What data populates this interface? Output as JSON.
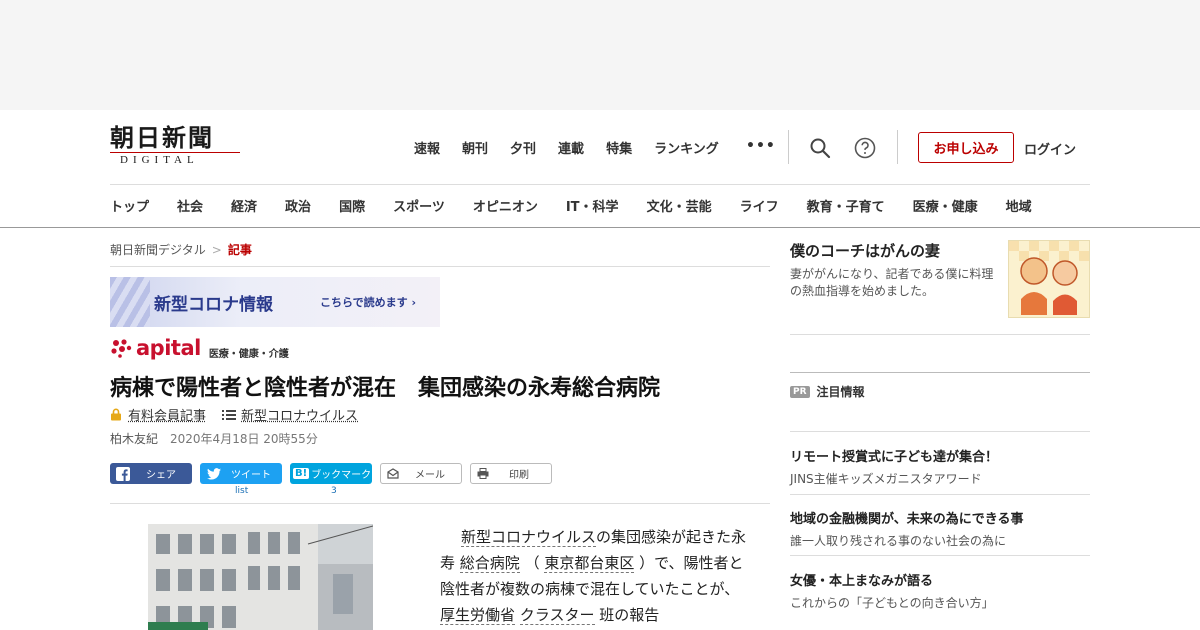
{
  "logo": {
    "main": "朝日新聞",
    "sub": "DIGITAL"
  },
  "topnav": [
    "速報",
    "朝刊",
    "夕刊",
    "連載",
    "特集",
    "ランキング"
  ],
  "more_label": "•••",
  "apply_label": "お申し込み",
  "login_label": "ログイン",
  "catnav": [
    "トップ",
    "社会",
    "経済",
    "政治",
    "国際",
    "スポーツ",
    "オピニオン",
    "IT・科学",
    "文化・芸能",
    "ライフ",
    "教育・子育て",
    "医療・健康",
    "地域"
  ],
  "breadcrumb": {
    "home": "朝日新聞デジタル",
    "sep": ">",
    "current": "記事"
  },
  "corona": {
    "title": "新型コロナ情報",
    "link": "こちらで読めます"
  },
  "apital": {
    "word": "apital",
    "sub": "医療・健康・介護"
  },
  "article": {
    "headline": "病棟で陽性者と陰性者が混在　集団感染の永寿総合病院",
    "member": "有料会員記事",
    "topic": "新型コロナウイルス",
    "author": "柏木友紀",
    "date": "2020年4月18日 20時55分",
    "body": {
      "p1_a": "新型コロナウイルス",
      "p1_b": "の集団感染が起きた永寿 ",
      "p1_c": "総合病院",
      "p1_d": " （ ",
      "p1_e": "東京都台東区",
      "p1_f": " ）で、陽性者と陰性者が複数の病棟で混在していたことが、 ",
      "p1_g": "厚生労働省",
      "p1_h": " ",
      "p1_i": "クラスター",
      "p1_j": " 班の報告"
    }
  },
  "share": {
    "facebook": "シェア",
    "twitter": "ツイート",
    "twitter_count": "list",
    "hatena_badge": "B!",
    "hatena": "ブックマーク",
    "hatena_count": "3",
    "mail": "メール",
    "print": "印刷"
  },
  "promo": {
    "title": "僕のコーチはがんの妻",
    "desc": "妻ががんになり、記者である僕に料理の熱血指導を始めました。"
  },
  "pr": {
    "badge": "PR",
    "title": "注目情報",
    "items": [
      {
        "title": "リモート授賞式に子ども達が集合！",
        "sub": "JINS主催キッズメガニスタアワード"
      },
      {
        "title": "地域の金融機関が、未来の為にできる事",
        "sub": "誰一人取り残される事のない社会の為に"
      },
      {
        "title": "女優・本上まなみが語る",
        "sub": "これからの「子どもとの向き合い方」"
      }
    ]
  },
  "colors": {
    "brand_red": "#b00000",
    "apital_red": "#c8102e",
    "facebook": "#3b5998",
    "twitter": "#1da1f2",
    "hatena": "#00a4de"
  }
}
